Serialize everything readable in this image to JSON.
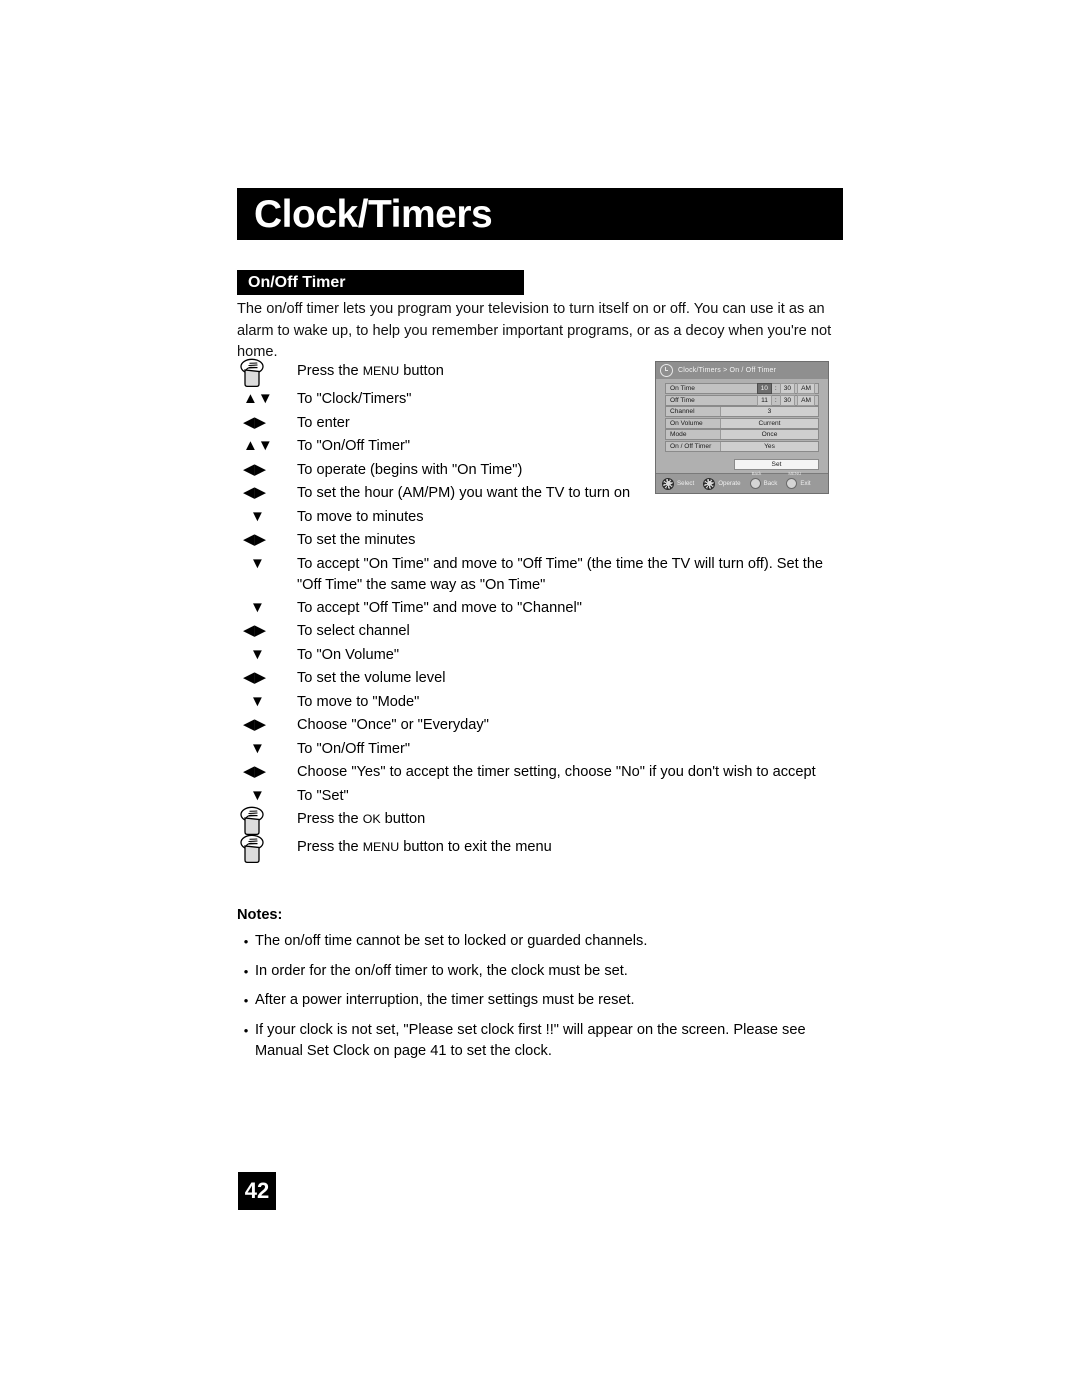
{
  "page": {
    "title": "Clock/Timers",
    "section_heading": "On/Off Timer",
    "intro": "The on/off timer lets you program your television to turn itself on or off. You can use it as an alarm to wake up, to help you remember important programs, or as a decoy when you're not home.",
    "page_number": "42"
  },
  "steps": [
    {
      "icon": "hand-press-button-icon",
      "text_pre": "Press the ",
      "small_caps": "MENU",
      "text_post": " button"
    },
    {
      "icon": "up-down-arrows-icon",
      "text": "To \"Clock/Timers\""
    },
    {
      "icon": "left-right-arrows-icon",
      "text": "To enter"
    },
    {
      "icon": "up-down-arrows-icon",
      "text": "To \"On/Off Timer\""
    },
    {
      "icon": "left-right-arrows-icon",
      "text": "To operate (begins with \"On Time\")"
    },
    {
      "icon": "left-right-arrows-icon",
      "text": "To set the hour (AM/PM) you want the TV to turn on"
    },
    {
      "icon": "down-arrow-icon",
      "text": "To move to minutes"
    },
    {
      "icon": "left-right-arrows-icon",
      "text": "To set the minutes"
    },
    {
      "icon": "down-arrow-icon",
      "text": "To accept \"On Time\" and move to \"Off Time\" (the time the TV will turn off). Set the \"Off Time\" the same way as \"On Time\""
    },
    {
      "icon": "down-arrow-icon",
      "text": "To accept \"Off Time\" and move to \"Channel\""
    },
    {
      "icon": "left-right-arrows-icon",
      "text": "To select channel"
    },
    {
      "icon": "down-arrow-icon",
      "text": "To \"On Volume\""
    },
    {
      "icon": "left-right-arrows-icon",
      "text": "To set the volume level"
    },
    {
      "icon": "down-arrow-icon",
      "text": "To move to \"Mode\""
    },
    {
      "icon": "left-right-arrows-icon",
      "text": "Choose \"Once\" or \"Everyday\""
    },
    {
      "icon": "down-arrow-icon",
      "text": "To \"On/Off Timer\""
    },
    {
      "icon": "left-right-arrows-icon",
      "text": "Choose \"Yes\" to accept the timer setting, choose \"No\" if you don't wish to accept"
    },
    {
      "icon": "down-arrow-icon",
      "text": "To \"Set\""
    },
    {
      "icon": "hand-press-button-icon",
      "text_pre": "Press the ",
      "small_caps": "OK",
      "text_post": " button"
    },
    {
      "icon": "hand-press-button-icon",
      "text_pre": "Press the ",
      "small_caps": "MENU",
      "text_post": " button to exit the menu"
    }
  ],
  "notes": {
    "title": "Notes:",
    "items": [
      "The on/off time cannot be set to locked or guarded channels.",
      "In order for the on/off timer to work, the clock must be set.",
      "After a power interruption, the timer settings must be reset.",
      "If your clock is not set, \"Please set clock first !!\" will appear on the screen.  Please see Manual Set Clock on page 41 to set the clock."
    ],
    "bullet": "•"
  },
  "osd": {
    "breadcrumb": "Clock/Timers > On / Off Timer",
    "clock_icon": "clock-icon",
    "rows": [
      {
        "label": "On Time",
        "type": "time",
        "hour": "10",
        "colon": ":",
        "minute": "30",
        "meridiem": "AM",
        "selected": "hour"
      },
      {
        "label": "Off Time",
        "type": "time",
        "hour": "11",
        "colon": ":",
        "minute": "30",
        "meridiem": "AM",
        "selected": "none"
      },
      {
        "label": "Channel",
        "type": "value",
        "value": "3"
      },
      {
        "label": "On Volume",
        "type": "value",
        "value": "Current"
      },
      {
        "label": "Mode",
        "type": "value",
        "value": "Once"
      },
      {
        "label": "On / Off Timer",
        "type": "value",
        "value": "Yes"
      }
    ],
    "set_button": "Set",
    "footer": [
      {
        "icon": "dpad-icon",
        "label": "Select",
        "top": ""
      },
      {
        "icon": "dpad-icon",
        "label": "Operate",
        "top": ""
      },
      {
        "icon": "round-button-icon",
        "label": "Back",
        "top": "Back"
      },
      {
        "icon": "round-button-icon",
        "label": "Exit",
        "top": "MENU"
      }
    ]
  }
}
